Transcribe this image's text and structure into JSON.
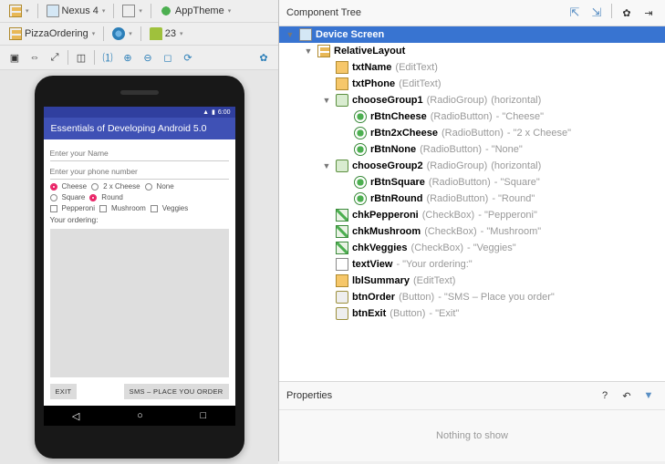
{
  "toolbar": {
    "device": "Nexus 4",
    "theme": "AppTheme",
    "module": "PizzaOrdering",
    "api": "23"
  },
  "statusbar": {
    "time": "6:00"
  },
  "app": {
    "title": "Essentials of Developing Android 5.0",
    "name_hint": "Enter your Name",
    "phone_hint": "Enter your phone number",
    "rb_cheese": "Cheese",
    "rb_2xcheese": "2 x Cheese",
    "rb_none": "None",
    "rb_square": "Square",
    "rb_round": "Round",
    "cb_pepperoni": "Pepperoni",
    "cb_mushroom": "Mushroom",
    "cb_veggies": "Veggies",
    "ordering_label": "Your ordering:",
    "btn_exit": "EXIT",
    "btn_order": "SMS – PLACE YOU ORDER"
  },
  "tree_header": "Component Tree",
  "tree": [
    {
      "d": 0,
      "t": "▼",
      "i": "i-device",
      "n": "Device Screen",
      "sel": true
    },
    {
      "d": 1,
      "t": "▼",
      "i": "i-layout",
      "n": "RelativeLayout"
    },
    {
      "d": 2,
      "t": "",
      "i": "i-edit",
      "n": "txtName",
      "ty": "(EditText)"
    },
    {
      "d": 2,
      "t": "",
      "i": "i-edit",
      "n": "txtPhone",
      "ty": "(EditText)"
    },
    {
      "d": 2,
      "t": "▼",
      "i": "i-rg",
      "n": "chooseGroup1",
      "ty": "(RadioGroup)",
      "tx": "(horizontal)"
    },
    {
      "d": 3,
      "t": "",
      "i": "i-rb",
      "n": "rBtnCheese",
      "ty": "(RadioButton)",
      "tx": "- \"Cheese\""
    },
    {
      "d": 3,
      "t": "",
      "i": "i-rb",
      "n": "rBtn2xCheese",
      "ty": "(RadioButton)",
      "tx": "- \"2 x Cheese\""
    },
    {
      "d": 3,
      "t": "",
      "i": "i-rb",
      "n": "rBtnNone",
      "ty": "(RadioButton)",
      "tx": "- \"None\""
    },
    {
      "d": 2,
      "t": "▼",
      "i": "i-rg",
      "n": "chooseGroup2",
      "ty": "(RadioGroup)",
      "tx": "(horizontal)"
    },
    {
      "d": 3,
      "t": "",
      "i": "i-rb",
      "n": "rBtnSquare",
      "ty": "(RadioButton)",
      "tx": "- \"Square\""
    },
    {
      "d": 3,
      "t": "",
      "i": "i-rb",
      "n": "rBtnRound",
      "ty": "(RadioButton)",
      "tx": "- \"Round\""
    },
    {
      "d": 2,
      "t": "",
      "i": "i-cb",
      "n": "chkPepperoni",
      "ty": "(CheckBox)",
      "tx": "- \"Pepperoni\""
    },
    {
      "d": 2,
      "t": "",
      "i": "i-cb",
      "n": "chkMushroom",
      "ty": "(CheckBox)",
      "tx": "- \"Mushroom\""
    },
    {
      "d": 2,
      "t": "",
      "i": "i-cb",
      "n": "chkVeggies",
      "ty": "(CheckBox)",
      "tx": "- \"Veggies\""
    },
    {
      "d": 2,
      "t": "",
      "i": "i-tv",
      "n": "textView",
      "tx": "- \"Your ordering:\""
    },
    {
      "d": 2,
      "t": "",
      "i": "i-edit",
      "n": "lblSummary",
      "ty": "(EditText)"
    },
    {
      "d": 2,
      "t": "",
      "i": "i-bn",
      "n": "btnOrder",
      "ty": "(Button)",
      "tx": "- \"SMS – Place you order\""
    },
    {
      "d": 2,
      "t": "",
      "i": "i-bn",
      "n": "btnExit",
      "ty": "(Button)",
      "tx": "- \"Exit\""
    }
  ],
  "props": {
    "title": "Properties",
    "empty": "Nothing to show"
  }
}
